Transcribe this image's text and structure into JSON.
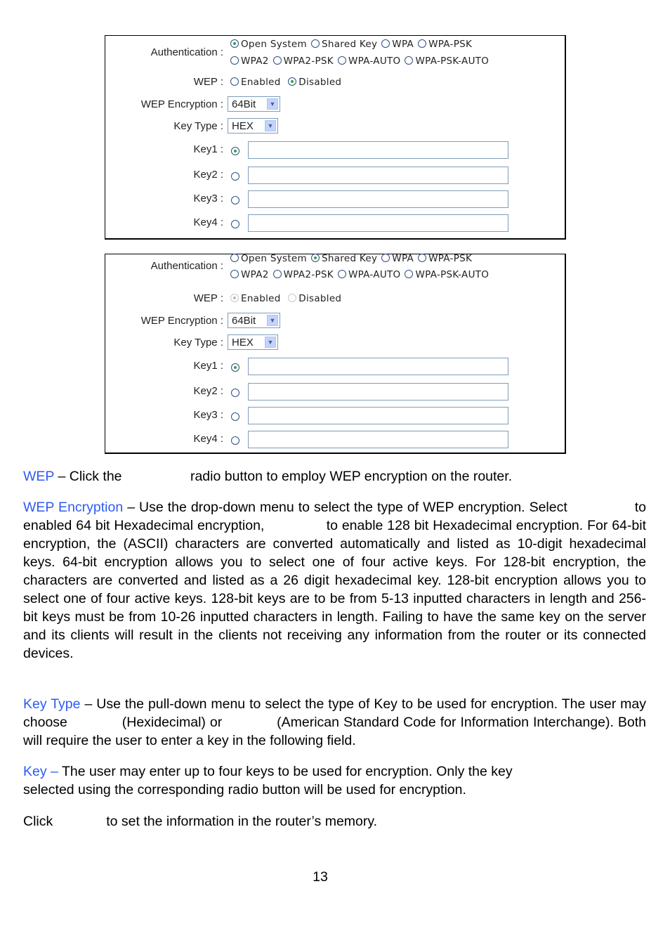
{
  "panels": [
    {
      "auth_label": "Authentication :",
      "auth_options_row1": [
        {
          "label": "Open System",
          "checked": true
        },
        {
          "label": "Shared Key",
          "checked": false
        },
        {
          "label": "WPA",
          "checked": false
        },
        {
          "label": "WPA-PSK",
          "checked": false
        }
      ],
      "auth_options_row2": [
        {
          "label": "WPA2",
          "checked": false
        },
        {
          "label": "WPA2-PSK",
          "checked": false
        },
        {
          "label": "WPA-AUTO",
          "checked": false
        },
        {
          "label": "WPA-PSK-AUTO",
          "checked": false
        }
      ],
      "wep_label": "WEP :",
      "wep_enabled": "Enabled",
      "wep_disabled": "Disabled",
      "wep_state": "disabled",
      "wep_options_disabled": false,
      "wep_encryption_label": "WEP Encryption :",
      "wep_encryption_value": "64Bit",
      "key_type_label": "Key Type :",
      "key_type_value": "HEX",
      "keys": [
        {
          "label": "Key1 :",
          "selected": true,
          "value": ""
        },
        {
          "label": "Key2 :",
          "selected": false,
          "value": ""
        },
        {
          "label": "Key3 :",
          "selected": false,
          "value": ""
        },
        {
          "label": "Key4 :",
          "selected": false,
          "value": ""
        }
      ]
    },
    {
      "auth_label": "Authentication :",
      "auth_options_row1": [
        {
          "label": "Open System",
          "checked": false
        },
        {
          "label": "Shared Key",
          "checked": true
        },
        {
          "label": "WPA",
          "checked": false
        },
        {
          "label": "WPA-PSK",
          "checked": false
        }
      ],
      "auth_options_row2": [
        {
          "label": "WPA2",
          "checked": false
        },
        {
          "label": "WPA2-PSK",
          "checked": false
        },
        {
          "label": "WPA-AUTO",
          "checked": false
        },
        {
          "label": "WPA-PSK-AUTO",
          "checked": false
        }
      ],
      "wep_label": "WEP :",
      "wep_enabled": "Enabled",
      "wep_disabled": "Disabled",
      "wep_state": "enabled",
      "wep_options_disabled": true,
      "wep_encryption_label": "WEP Encryption :",
      "wep_encryption_value": "64Bit",
      "key_type_label": "Key Type :",
      "key_type_value": "HEX",
      "keys": [
        {
          "label": "Key1 :",
          "selected": true,
          "value": ""
        },
        {
          "label": "Key2 :",
          "selected": false,
          "value": ""
        },
        {
          "label": "Key3 :",
          "selected": false,
          "value": ""
        },
        {
          "label": "Key4 :",
          "selected": false,
          "value": ""
        }
      ]
    }
  ],
  "text": {
    "wep_term": "WEP",
    "wep_desc_a": " – Click the ",
    "wep_desc_b": "radio button to employ WEP encryption on the router.",
    "wepenc_term": "WEP Encryption",
    "wepenc_desc": " – Use the drop-down menu to select the type of WEP encryption. Select                to enabled 64 bit Hexadecimal encryption,               to enable 128 bit Hexadecimal encryption. For 64-bit encryption, the (ASCII) characters are converted automatically and listed as 10-digit hexadecimal keys. 64-bit encryption allows you to select one of four active keys. For 128-bit encryption, the characters are converted and listed as a 26 digit hexadecimal key. 128-bit encryption allows you to select one of four active keys. 128-bit keys are to be from 5-13 inputted characters in length and 256-bit keys must be from 10-26 inputted characters in length. Failing to have the same key on the server and its clients will result in the clients not receiving any information from the router or its connected devices.",
    "keytype_term": "Key Type",
    "keytype_desc": " – Use the pull-down menu to select the type of Key to be used for encryption. The user may choose             (Hexidecimal) or             (American Standard Code for Information Interchange). Both will require the user to enter a key in the following field.",
    "key_term": "Key –",
    "key_desc_line1": " The user may enter up to four keys to be used for encryption. Only the key",
    "key_desc_line2": "selected using the corresponding radio button will be used for encryption.",
    "click_a": "Click",
    "click_b": "to set the information in the router’s memory."
  },
  "page_number": "13",
  "colors": {
    "term_blue": "#2d5bf0",
    "radio_dot_green": "#2ea24a"
  }
}
